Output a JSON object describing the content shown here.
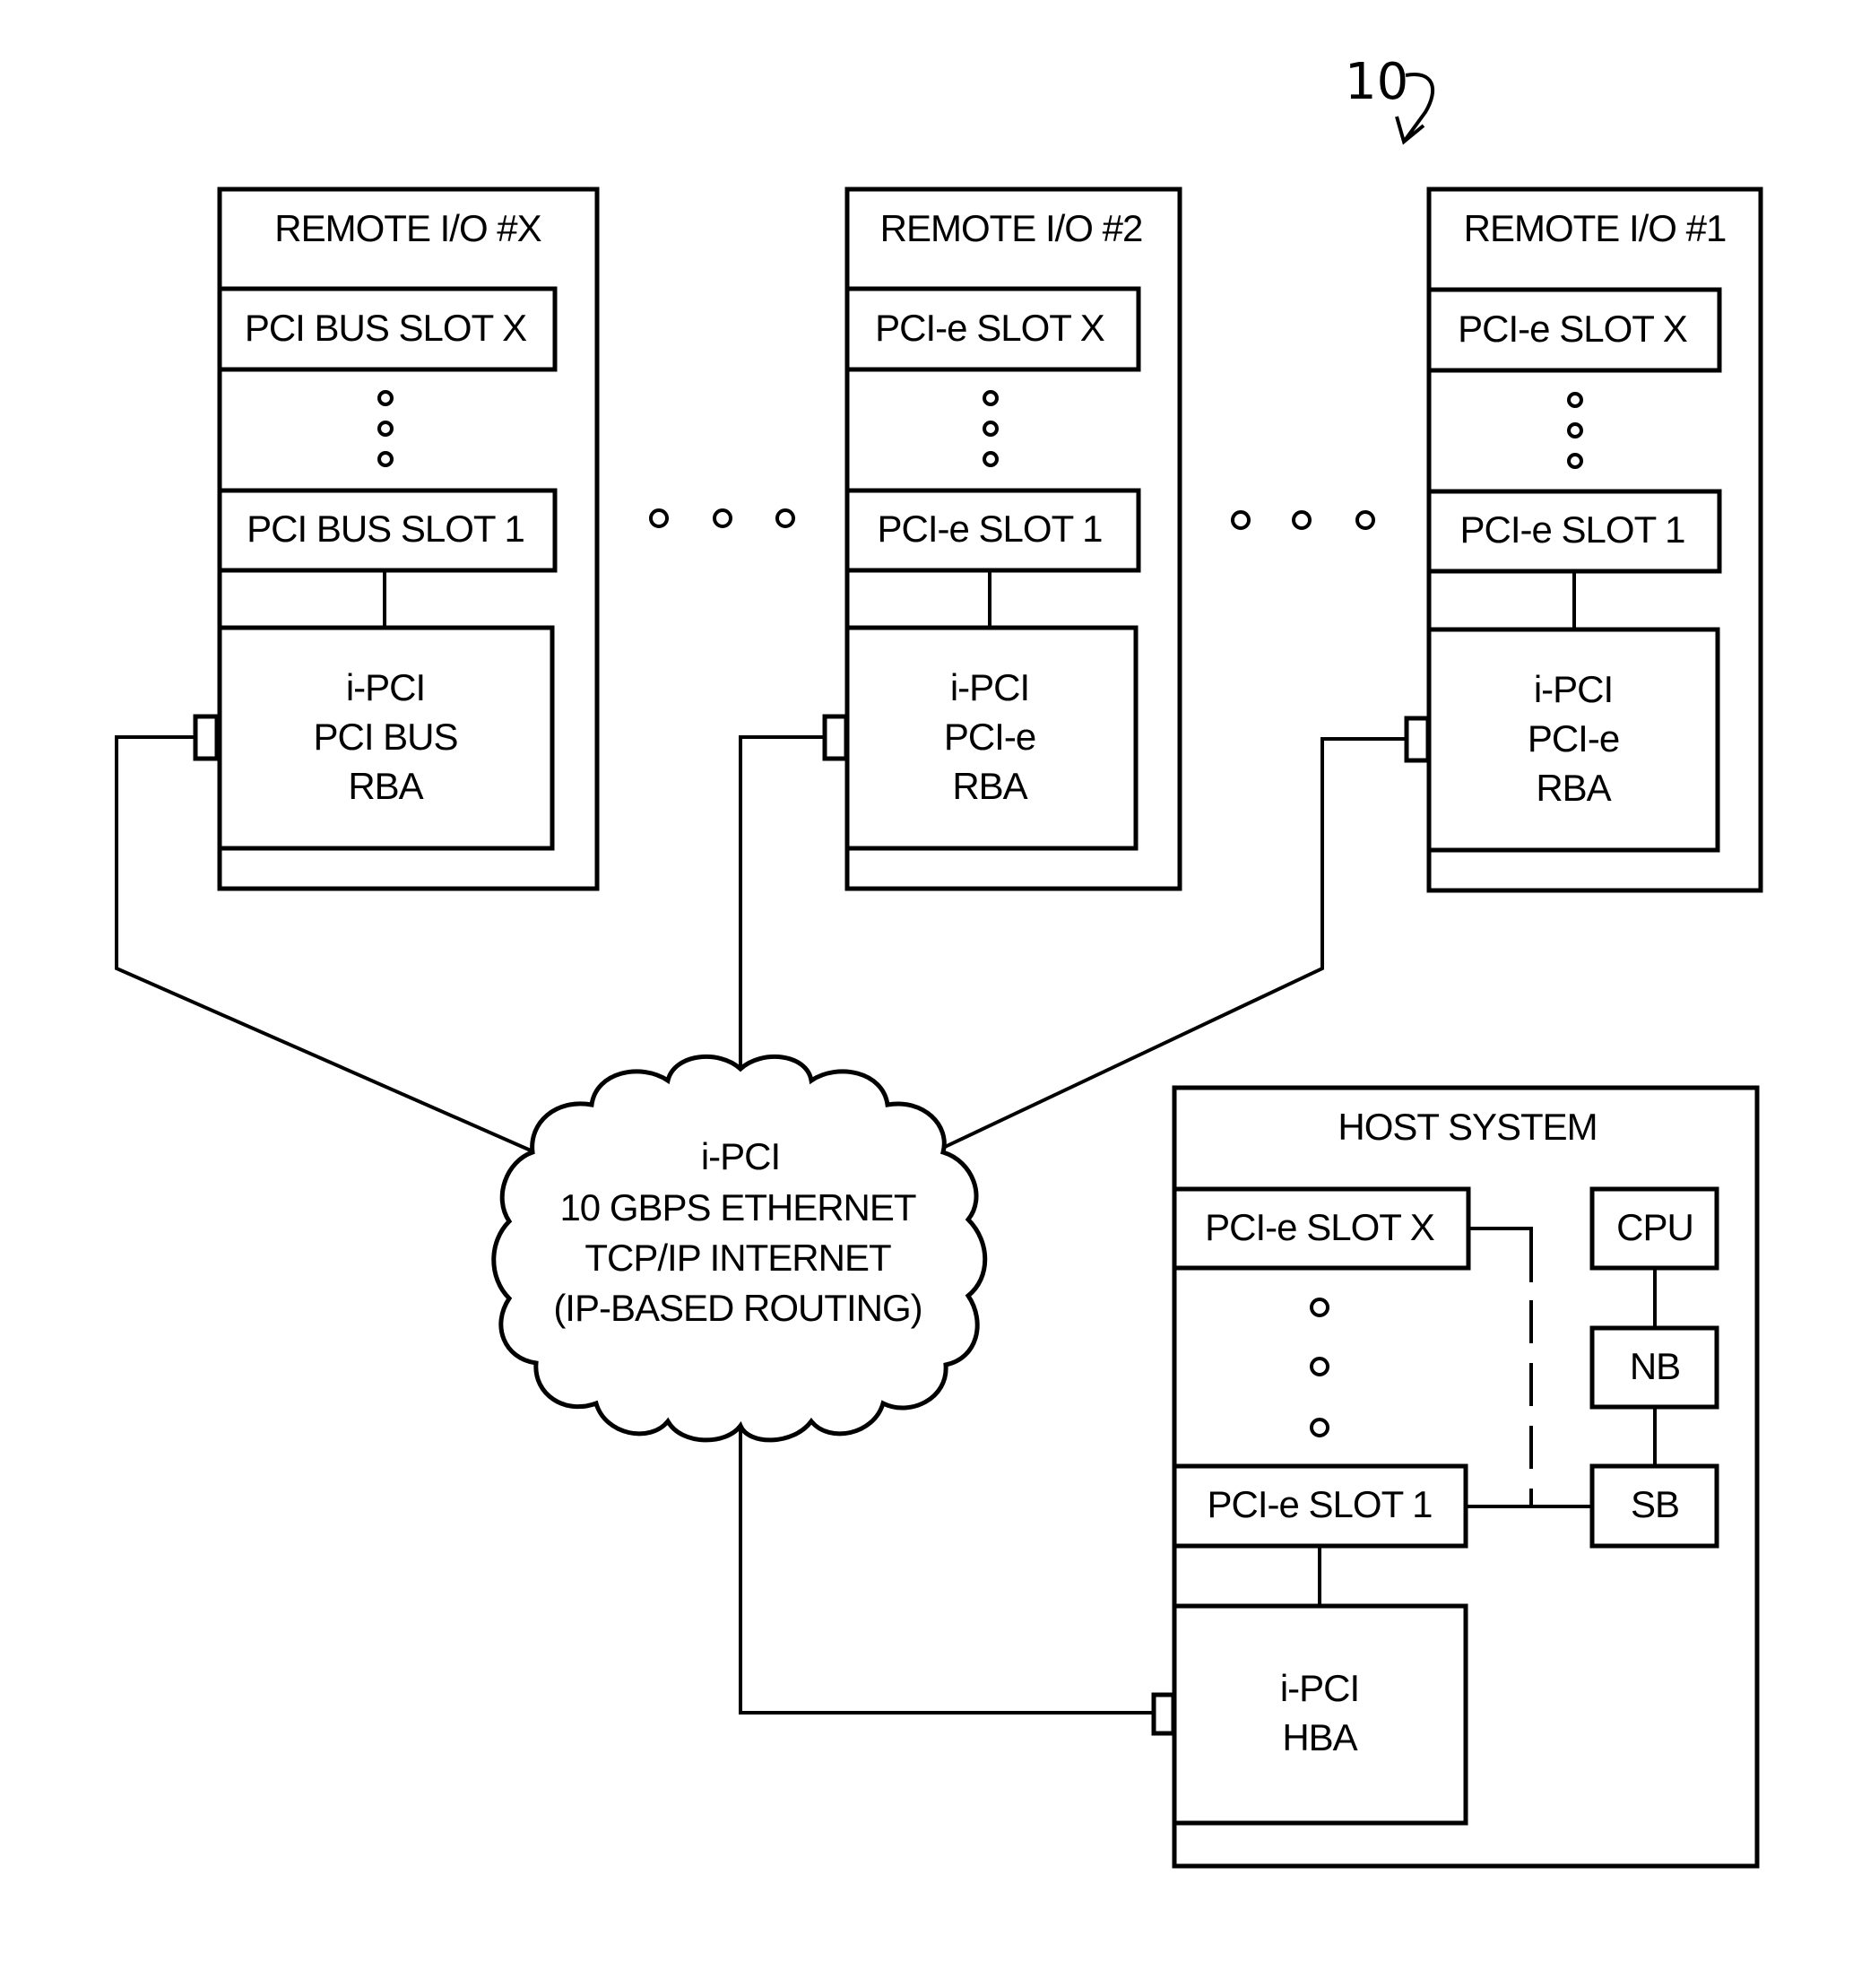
{
  "figure": {
    "reference_numeral": "10"
  },
  "remote_units": [
    {
      "title": "REMOTE I/O #X",
      "slot_top": "PCI BUS SLOT X",
      "slot_bottom": "PCI BUS SLOT 1",
      "adapter_lines": [
        "i-PCI",
        "PCI BUS",
        "RBA"
      ]
    },
    {
      "title": "REMOTE I/O #2",
      "slot_top": "PCI-e SLOT X",
      "slot_bottom": "PCI-e SLOT 1",
      "adapter_lines": [
        "i-PCI",
        "PCI-e",
        "RBA"
      ]
    },
    {
      "title": "REMOTE I/O #1",
      "slot_top": "PCI-e SLOT X",
      "slot_bottom": "PCI-e SLOT 1",
      "adapter_lines": [
        "i-PCI",
        "PCI-e",
        "RBA"
      ]
    }
  ],
  "network": {
    "lines": [
      "i-PCI",
      "10 GBPS ETHERNET",
      "TCP/IP INTERNET",
      "(IP-BASED ROUTING)"
    ]
  },
  "host": {
    "title": "HOST SYSTEM",
    "slot_top": "PCI-e SLOT X",
    "slot_bottom": "PCI-e SLOT 1",
    "adapter_lines": [
      "i-PCI",
      "HBA"
    ],
    "chips": {
      "cpu": "CPU",
      "nb": "NB",
      "sb": "SB"
    }
  }
}
